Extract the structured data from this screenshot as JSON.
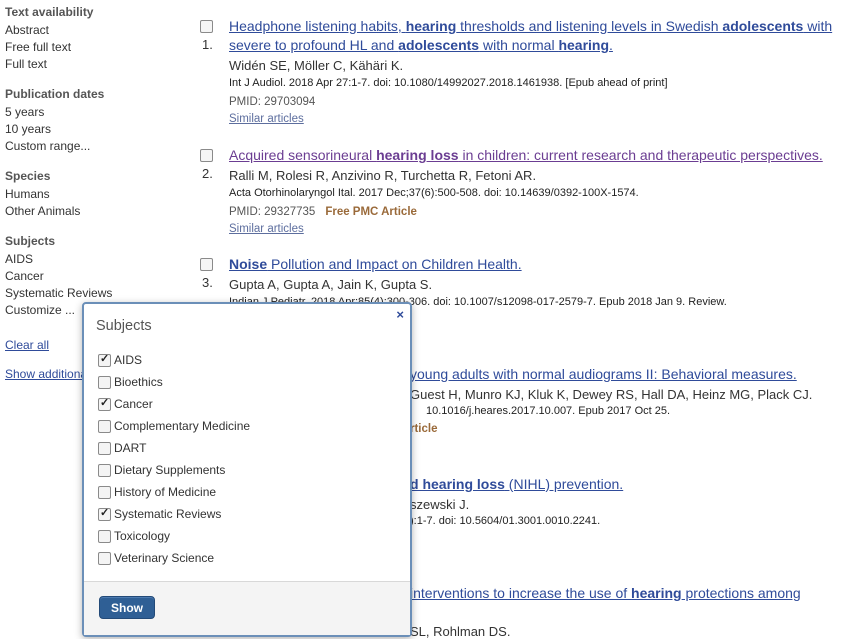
{
  "sidebar": {
    "groups": [
      {
        "heading": "Text availability",
        "items": [
          "Abstract",
          "Free full text",
          "Full text"
        ]
      },
      {
        "heading": "Publication dates",
        "items": [
          "5 years",
          "10 years",
          "Custom range..."
        ]
      },
      {
        "heading": "Species",
        "items": [
          "Humans",
          "Other Animals"
        ]
      },
      {
        "heading": "Subjects",
        "items": [
          "AIDS",
          "Cancer",
          "Systematic Reviews",
          "Customize ..."
        ]
      }
    ],
    "clear_all": "Clear all",
    "show_additional": "Show additional filters"
  },
  "results": [
    {
      "number": "1.",
      "title_parts": [
        {
          "t": "Headphone listening habits, ",
          "b": false
        },
        {
          "t": "hearing",
          "b": true
        },
        {
          "t": " thresholds and listening levels in Swedish ",
          "b": false
        },
        {
          "t": "adolescents",
          "b": true
        },
        {
          "t": " with severe to profound HL and ",
          "b": false
        },
        {
          "t": "adolescents",
          "b": true
        },
        {
          "t": " with normal ",
          "b": false
        },
        {
          "t": "hearing",
          "b": true
        },
        {
          "t": ".",
          "b": false
        }
      ],
      "authors": "Widén SE, Möller C, Kähäri K.",
      "journal": "Int J Audiol. 2018 Apr 27:1-7. doi: 10.1080/14992027.2018.1461938. [Epub ahead of print]",
      "pmid": "PMID: 29703094",
      "pmc": "",
      "similar": "Similar articles",
      "visited": false
    },
    {
      "number": "2.",
      "title_parts": [
        {
          "t": "Acquired sensorineural ",
          "b": false
        },
        {
          "t": "hearing loss",
          "b": true
        },
        {
          "t": " in children: current research and therapeutic perspectives.",
          "b": false
        }
      ],
      "authors": "Ralli M, Rolesi R, Anzivino R, Turchetta R, Fetoni AR.",
      "journal": "Acta Otorhinolaryngol Ital. 2017 Dec;37(6):500-508. doi: 10.14639/0392-100X-1574.",
      "pmid": "PMID: 29327735",
      "pmc": "Free PMC Article",
      "similar": "Similar articles",
      "visited": true
    },
    {
      "number": "3.",
      "title_parts": [
        {
          "t": "Noise",
          "b": true
        },
        {
          "t": " Pollution and Impact on Children Health.",
          "b": false
        }
      ],
      "authors": "Gupta A, Gupta A, Jain K, Gupta S.",
      "journal": "Indian J Pediatr. 2018 Apr;85(4):300-306. doi: 10.1007/s12098-017-2579-7. Epub 2018 Jan 9. Review.",
      "visited": false
    }
  ],
  "partial": {
    "r4_title": "young adults with normal audiograms II: Behavioral measures.",
    "r4_authors": "Guest H, Munro KJ, Kluk K, Dewey RS, Hall DA, Heinz MG, Plack CJ.",
    "r4_journal": "10.1016/j.heares.2017.10.007. Epub 2017 Oct 25.",
    "r4_pmc": "rticle",
    "r5_bold": "d hearing loss",
    "r5_rest": " (NIHL) prevention.",
    "r5_authors": "szewski J.",
    "r5_journal": "):1-7. doi: 10.5604/01.3001.0010.2241.",
    "r6_title_a": " interventions to increase the use of ",
    "r6_title_b": "hearing",
    "r6_title_c": " protections among",
    "r6_authors": "SL, Rohlman DS."
  },
  "popup": {
    "title": "Subjects",
    "close": "×",
    "options": [
      {
        "label": "AIDS",
        "checked": true
      },
      {
        "label": "Bioethics",
        "checked": false
      },
      {
        "label": "Cancer",
        "checked": true
      },
      {
        "label": "Complementary Medicine",
        "checked": false
      },
      {
        "label": "DART",
        "checked": false
      },
      {
        "label": "Dietary Supplements",
        "checked": false
      },
      {
        "label": "History of Medicine",
        "checked": false
      },
      {
        "label": "Systematic Reviews",
        "checked": true
      },
      {
        "label": "Toxicology",
        "checked": false
      },
      {
        "label": "Veterinary Science",
        "checked": false
      }
    ],
    "show_button": "Show"
  }
}
